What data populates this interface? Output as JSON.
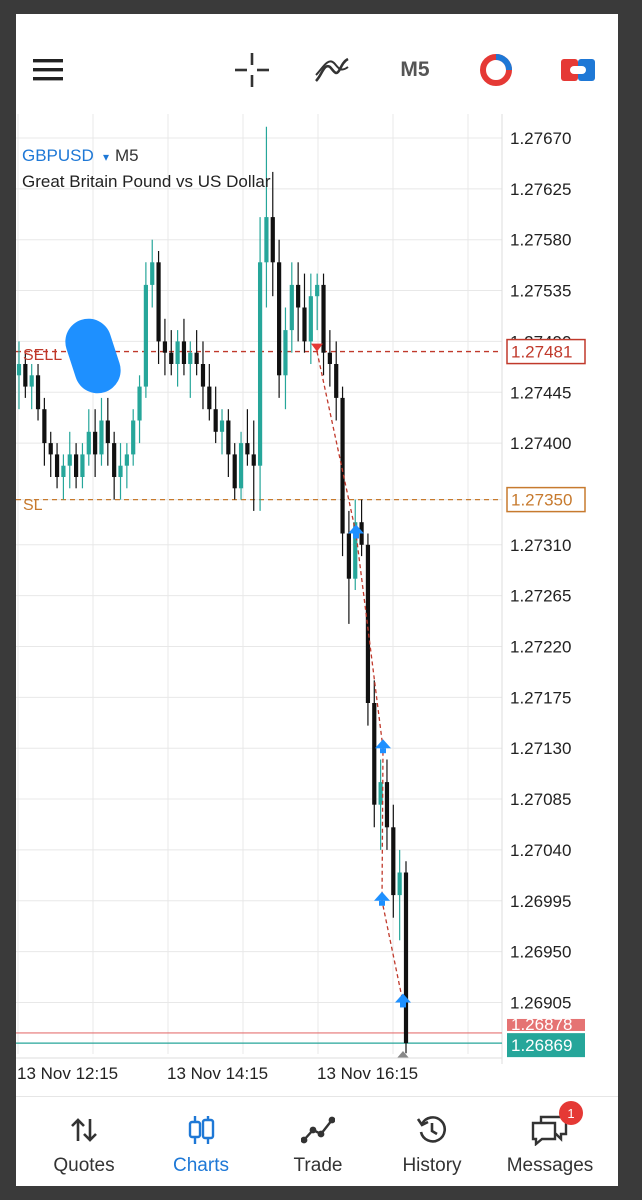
{
  "toolbar": {
    "menu_icon": "hamburger-menu-icon",
    "crosshair_icon": "crosshair-icon",
    "indicators_icon": "indicators-icon",
    "timeframe": "M5",
    "trade_icon": "one-click-trading-icon",
    "toggle_icon": "toggle-icon"
  },
  "chart": {
    "symbol": "GBPUSD",
    "symbol_arrow": "▾",
    "timeframe": "M5",
    "description": "Great Britain Pound vs US Dollar",
    "price_ticks": [
      "1.27670",
      "1.27625",
      "1.27580",
      "1.27535",
      "1.27490",
      "1.27445",
      "1.27400",
      "1.27350",
      "1.27310",
      "1.27265",
      "1.27220",
      "1.27175",
      "1.27130",
      "1.27085",
      "1.27040",
      "1.26995",
      "1.26950",
      "1.26905",
      "1.26870"
    ],
    "time_labels": [
      "13 Nov 12:15",
      "13 Nov 14:15",
      "13 Nov 16:15"
    ],
    "sell_line": {
      "label": "SELL",
      "price": "1.27481",
      "color": "#c0392b"
    },
    "sl_line": {
      "label": "SL",
      "price": "1.27350",
      "color": "#c77a2e"
    },
    "ask_price": "1.26878",
    "bid_price": "1.26869",
    "colors": {
      "bull": "#26a69a",
      "bear": "#111111",
      "grid": "#e8e8e8",
      "blue_marker": "#1e90ff"
    }
  },
  "chart_data": {
    "type": "candlestick",
    "symbol": "GBPUSD",
    "timeframe": "M5",
    "ylim": [
      1.2685,
      1.277
    ],
    "x_labels": [
      "13 Nov 12:15",
      "13 Nov 14:15",
      "13 Nov 16:15"
    ],
    "candles": [
      {
        "o": 1.2746,
        "h": 1.2749,
        "l": 1.2743,
        "c": 1.2747
      },
      {
        "o": 1.2747,
        "h": 1.2748,
        "l": 1.2744,
        "c": 1.2745
      },
      {
        "o": 1.2745,
        "h": 1.2747,
        "l": 1.2743,
        "c": 1.2746
      },
      {
        "o": 1.2746,
        "h": 1.2747,
        "l": 1.2742,
        "c": 1.2743
      },
      {
        "o": 1.2743,
        "h": 1.2744,
        "l": 1.2738,
        "c": 1.274
      },
      {
        "o": 1.274,
        "h": 1.2741,
        "l": 1.2737,
        "c": 1.2739
      },
      {
        "o": 1.2739,
        "h": 1.274,
        "l": 1.2736,
        "c": 1.2737
      },
      {
        "o": 1.2737,
        "h": 1.2739,
        "l": 1.2735,
        "c": 1.2738
      },
      {
        "o": 1.2738,
        "h": 1.2741,
        "l": 1.2736,
        "c": 1.2739
      },
      {
        "o": 1.2739,
        "h": 1.274,
        "l": 1.2736,
        "c": 1.2737
      },
      {
        "o": 1.2737,
        "h": 1.274,
        "l": 1.2736,
        "c": 1.2739
      },
      {
        "o": 1.2739,
        "h": 1.2743,
        "l": 1.2738,
        "c": 1.2741
      },
      {
        "o": 1.2741,
        "h": 1.2743,
        "l": 1.2737,
        "c": 1.2739
      },
      {
        "o": 1.2739,
        "h": 1.2744,
        "l": 1.2738,
        "c": 1.2742
      },
      {
        "o": 1.2742,
        "h": 1.2744,
        "l": 1.2738,
        "c": 1.274
      },
      {
        "o": 1.274,
        "h": 1.2741,
        "l": 1.2735,
        "c": 1.2737
      },
      {
        "o": 1.2737,
        "h": 1.274,
        "l": 1.2735,
        "c": 1.2738
      },
      {
        "o": 1.2738,
        "h": 1.274,
        "l": 1.2736,
        "c": 1.2739
      },
      {
        "o": 1.2739,
        "h": 1.2743,
        "l": 1.2738,
        "c": 1.2742
      },
      {
        "o": 1.2742,
        "h": 1.2746,
        "l": 1.274,
        "c": 1.2745
      },
      {
        "o": 1.2745,
        "h": 1.2756,
        "l": 1.2744,
        "c": 1.2754
      },
      {
        "o": 1.2754,
        "h": 1.2758,
        "l": 1.2752,
        "c": 1.2756
      },
      {
        "o": 1.2756,
        "h": 1.2757,
        "l": 1.2747,
        "c": 1.2749
      },
      {
        "o": 1.2749,
        "h": 1.2751,
        "l": 1.2746,
        "c": 1.2748
      },
      {
        "o": 1.2748,
        "h": 1.275,
        "l": 1.2746,
        "c": 1.2747
      },
      {
        "o": 1.2747,
        "h": 1.275,
        "l": 1.2745,
        "c": 1.2749
      },
      {
        "o": 1.2749,
        "h": 1.2751,
        "l": 1.2746,
        "c": 1.2747
      },
      {
        "o": 1.2747,
        "h": 1.2749,
        "l": 1.2744,
        "c": 1.2748
      },
      {
        "o": 1.2748,
        "h": 1.275,
        "l": 1.2746,
        "c": 1.2747
      },
      {
        "o": 1.2747,
        "h": 1.2749,
        "l": 1.2743,
        "c": 1.2745
      },
      {
        "o": 1.2745,
        "h": 1.2747,
        "l": 1.2742,
        "c": 1.2743
      },
      {
        "o": 1.2743,
        "h": 1.2745,
        "l": 1.274,
        "c": 1.2741
      },
      {
        "o": 1.2741,
        "h": 1.2743,
        "l": 1.2739,
        "c": 1.2742
      },
      {
        "o": 1.2742,
        "h": 1.2743,
        "l": 1.2737,
        "c": 1.2739
      },
      {
        "o": 1.2739,
        "h": 1.274,
        "l": 1.2735,
        "c": 1.2736
      },
      {
        "o": 1.2736,
        "h": 1.2741,
        "l": 1.2735,
        "c": 1.274
      },
      {
        "o": 1.274,
        "h": 1.2743,
        "l": 1.2738,
        "c": 1.2739
      },
      {
        "o": 1.2739,
        "h": 1.2742,
        "l": 1.2734,
        "c": 1.2738
      },
      {
        "o": 1.2738,
        "h": 1.276,
        "l": 1.2734,
        "c": 1.2756
      },
      {
        "o": 1.2756,
        "h": 1.2768,
        "l": 1.2752,
        "c": 1.276
      },
      {
        "o": 1.276,
        "h": 1.2764,
        "l": 1.2753,
        "c": 1.2756
      },
      {
        "o": 1.2756,
        "h": 1.2758,
        "l": 1.2744,
        "c": 1.2746
      },
      {
        "o": 1.2746,
        "h": 1.2752,
        "l": 1.2743,
        "c": 1.275
      },
      {
        "o": 1.275,
        "h": 1.2756,
        "l": 1.2748,
        "c": 1.2754
      },
      {
        "o": 1.2754,
        "h": 1.2756,
        "l": 1.2749,
        "c": 1.2752
      },
      {
        "o": 1.2752,
        "h": 1.2755,
        "l": 1.2748,
        "c": 1.2749
      },
      {
        "o": 1.2749,
        "h": 1.2755,
        "l": 1.2747,
        "c": 1.2753
      },
      {
        "o": 1.2753,
        "h": 1.2755,
        "l": 1.275,
        "c": 1.2754
      },
      {
        "o": 1.2754,
        "h": 1.2755,
        "l": 1.2746,
        "c": 1.2748
      },
      {
        "o": 1.2748,
        "h": 1.275,
        "l": 1.2745,
        "c": 1.2747
      },
      {
        "o": 1.2747,
        "h": 1.2749,
        "l": 1.2742,
        "c": 1.2744
      },
      {
        "o": 1.2744,
        "h": 1.2745,
        "l": 1.273,
        "c": 1.2732
      },
      {
        "o": 1.2732,
        "h": 1.2734,
        "l": 1.2724,
        "c": 1.2728
      },
      {
        "o": 1.2728,
        "h": 1.2735,
        "l": 1.2727,
        "c": 1.2733
      },
      {
        "o": 1.2733,
        "h": 1.2735,
        "l": 1.273,
        "c": 1.2731
      },
      {
        "o": 1.2731,
        "h": 1.2732,
        "l": 1.2715,
        "c": 1.2717
      },
      {
        "o": 1.2717,
        "h": 1.2719,
        "l": 1.2706,
        "c": 1.2708
      },
      {
        "o": 1.2708,
        "h": 1.2712,
        "l": 1.2704,
        "c": 1.271
      },
      {
        "o": 1.271,
        "h": 1.2712,
        "l": 1.2704,
        "c": 1.2706
      },
      {
        "o": 1.2706,
        "h": 1.2708,
        "l": 1.2698,
        "c": 1.27
      },
      {
        "o": 1.27,
        "h": 1.2704,
        "l": 1.2696,
        "c": 1.2702
      },
      {
        "o": 1.2702,
        "h": 1.2703,
        "l": 1.2686,
        "c": 1.26869
      }
    ],
    "markers": [
      {
        "type": "sell",
        "price": 1.27481
      },
      {
        "type": "buy",
        "price": 1.2732
      },
      {
        "type": "buy",
        "price": 1.2713
      },
      {
        "type": "buy",
        "price": 1.26995
      },
      {
        "type": "buy",
        "price": 1.26905
      }
    ],
    "price_lines": [
      {
        "label": "SELL",
        "price": 1.27481
      },
      {
        "label": "SL",
        "price": 1.2735
      },
      {
        "label": "ask",
        "price": 1.26878
      },
      {
        "label": "bid",
        "price": 1.26869
      }
    ]
  },
  "nav": [
    {
      "label": "Quotes",
      "icon": "quotes-arrows-icon",
      "active": false
    },
    {
      "label": "Charts",
      "icon": "charts-candles-icon",
      "active": true
    },
    {
      "label": "Trade",
      "icon": "trade-line-icon",
      "active": false
    },
    {
      "label": "History",
      "icon": "history-clock-icon",
      "active": false
    },
    {
      "label": "Messages",
      "icon": "messages-chat-icon",
      "active": false,
      "badge": "1"
    }
  ]
}
